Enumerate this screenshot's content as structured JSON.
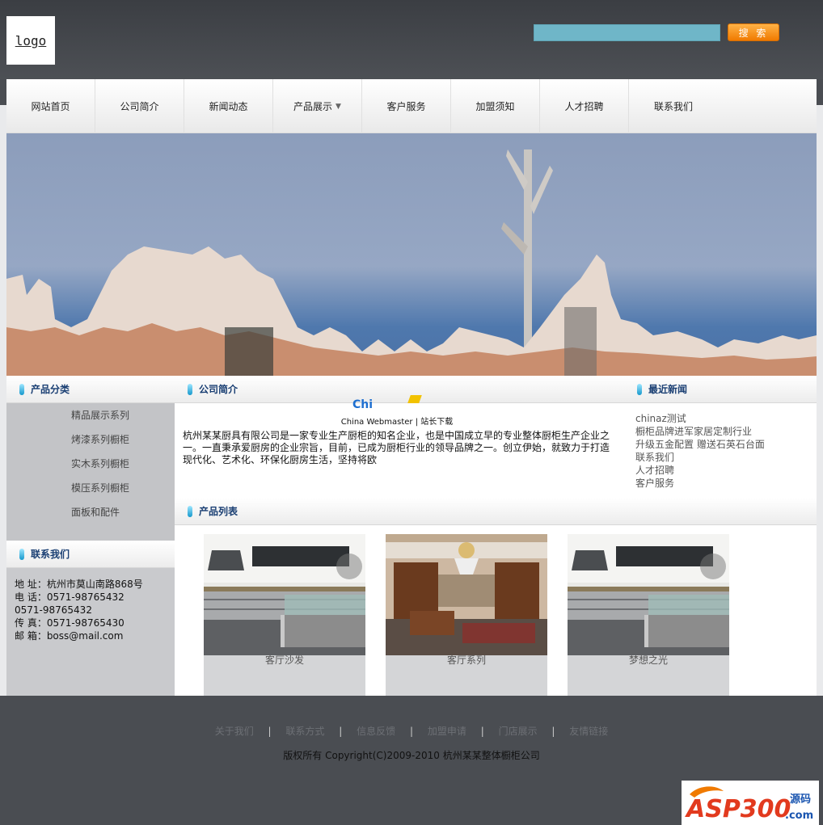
{
  "header": {
    "logo": "logo",
    "search_placeholder": "",
    "search_button": "搜 索"
  },
  "nav": {
    "items": [
      {
        "label": "网站首页"
      },
      {
        "label": "公司简介"
      },
      {
        "label": "新闻动态"
      },
      {
        "label": "产品展示"
      },
      {
        "label": "客户服务"
      },
      {
        "label": "加盟须知"
      },
      {
        "label": "人才招聘"
      },
      {
        "label": "联系我们"
      }
    ],
    "dropdown_arrow": "▼"
  },
  "left": {
    "categories_title": "产品分类",
    "categories": [
      "精品展示系列",
      "烤漆系列橱柜",
      "实木系列橱柜",
      "模压系列橱柜",
      "面板和配件"
    ],
    "contact_title": "联系我们",
    "contact_lines": [
      "地  址：杭州市莫山南路868号",
      "电  话：0571-98765432",
      "0571-98765432",
      "传  真：0571-98765430",
      "邮  箱：boss@mail.com"
    ]
  },
  "about": {
    "title": "公司简介",
    "credit": "China Webmaster | 站长下载",
    "text": "杭州某某厨具有限公司是一家专业生产厨柜的知名企业，也是中国成立早的专业整体厨柜生产企业之一。一直秉承爱厨房的企业宗旨，目前，已成为厨柜行业的领导品牌之一。创立伊始，就致力于打造现代化、艺术化、环保化厨房生活，坚持将欧"
  },
  "news": {
    "title": "最近新闻",
    "items": [
      "chinaz测试",
      "橱柜品牌进军家居定制行业",
      "升级五金配置 赠送石英石台面",
      "联系我们",
      "人才招聘",
      "客户服务"
    ]
  },
  "products": {
    "title": "产品列表",
    "items": [
      {
        "caption": "客厅沙发"
      },
      {
        "caption": "客厅系列"
      },
      {
        "caption": "梦想之光"
      }
    ]
  },
  "footer": {
    "links": [
      "关于我们",
      "联系方式",
      "信息反馈",
      "加盟申请",
      "门店展示",
      "友情链接"
    ],
    "separator": "|",
    "copyright": "版权所有  Copyright(C)2009-2010 杭州某某整体橱柜公司"
  },
  "watermark": {
    "text": "ASP300",
    "suffix": "源码",
    "domain": ".com"
  }
}
